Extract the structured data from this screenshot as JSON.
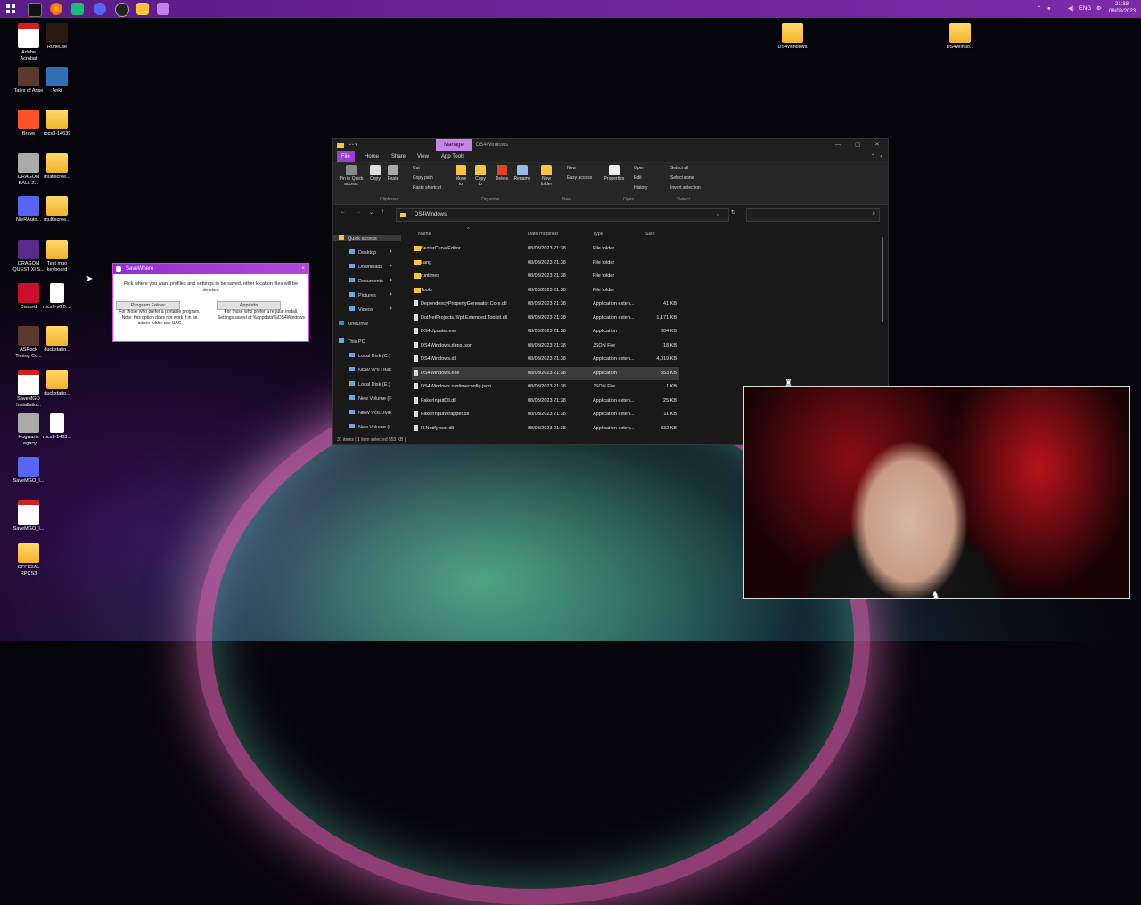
{
  "tray": {
    "lang": "ENG",
    "time": "21:38",
    "date": "08/03/2023"
  },
  "desktop_icons": [
    {
      "label": "Adobe\nAcrobat",
      "type": "pdf"
    },
    {
      "label": "RuneLite",
      "type": "app"
    },
    {
      "label": "Tales of Arise",
      "type": "app"
    },
    {
      "label": "Anki",
      "type": "app"
    },
    {
      "label": "Brave",
      "type": "app"
    },
    {
      "label": "rpcs3-14639",
      "type": "folder"
    },
    {
      "label": "DRAGON\nBALL Z...",
      "type": "app"
    },
    {
      "label": "multiscree...",
      "type": "folder"
    },
    {
      "label": "NieRAuto...",
      "type": "app"
    },
    {
      "label": "multiscree...",
      "type": "folder"
    },
    {
      "label": "DRAGON\nQUEST XI S...",
      "type": "app"
    },
    {
      "label": "Test mgo\nkeyboard",
      "type": "folder"
    },
    {
      "label": "Discord",
      "type": "app"
    },
    {
      "label": "rpcs3-v0.0....",
      "type": "file"
    },
    {
      "label": "ASRock\nTiming Co...",
      "type": "app"
    },
    {
      "label": "duckstatio...",
      "type": "folder"
    },
    {
      "label": "SaveMGO\nInstallatio...",
      "type": "pdf"
    },
    {
      "label": "duckstatio...",
      "type": "folder"
    },
    {
      "label": "Hogwarts\nLegacy",
      "type": "app"
    },
    {
      "label": "rpcs3-1463...",
      "type": "file"
    },
    {
      "label": "SaveMGO_I...",
      "type": "app"
    },
    {
      "label": "SaveMGO_I...",
      "type": "pdf"
    },
    {
      "label": "OFFICIAL\nRPCS3",
      "type": "folder"
    },
    {
      "label": "DS4Windows",
      "type": "folder"
    },
    {
      "label": "DS4Windo...",
      "type": "folder"
    }
  ],
  "explorer": {
    "window_title": "DS4Windows",
    "manage_tab": "Manage",
    "tabs": [
      "File",
      "Home",
      "Share",
      "View",
      "App Tools"
    ],
    "ribbon": {
      "pin": "Pin to Quick\naccess",
      "copy": "Copy",
      "paste": "Paste",
      "cut": "Cut",
      "copy_path": "Copy path",
      "paste_shortcut": "Paste shortcut",
      "move_to": "Move\nto",
      "copy_to": "Copy\nto",
      "delete": "Delete",
      "rename": "Rename",
      "new_folder": "New\nfolder",
      "new": "New",
      "easy_access": "Easy access",
      "properties": "Properties",
      "open": "Open",
      "edit": "Edit",
      "history": "History",
      "select_all": "Select all",
      "select_none": "Select none",
      "invert_selection": "Invert selection",
      "groups": [
        "Clipboard",
        "Organise",
        "New",
        "Open",
        "Select"
      ]
    },
    "address": "DS4Windows",
    "nav": [
      {
        "label": "Quick access",
        "level": 0,
        "pinned": false
      },
      {
        "label": "Desktop",
        "level": 1,
        "pinned": true
      },
      {
        "label": "Downloads",
        "level": 1,
        "pinned": true
      },
      {
        "label": "Documents",
        "level": 1,
        "pinned": true
      },
      {
        "label": "Pictures",
        "level": 1,
        "pinned": true
      },
      {
        "label": "Videos",
        "level": 1,
        "pinned": true
      },
      {
        "label": "OneDrive",
        "level": 0,
        "pinned": false
      },
      {
        "label": "This PC",
        "level": 0,
        "pinned": false
      },
      {
        "label": "Local Disk (C:)",
        "level": 1,
        "pinned": false
      },
      {
        "label": "NEW VOLUME",
        "level": 1,
        "pinned": false
      },
      {
        "label": "Local Disk (E:)",
        "level": 1,
        "pinned": false
      },
      {
        "label": "New Volume (F",
        "level": 1,
        "pinned": false
      },
      {
        "label": "NEW VOLUME",
        "level": 1,
        "pinned": false
      },
      {
        "label": "New Volume (I",
        "level": 1,
        "pinned": false
      }
    ],
    "columns": [
      "Name",
      "Date modified",
      "Type",
      "Size"
    ],
    "files": [
      {
        "name": "BezierCurveEditor",
        "date": "08/03/2023 21:38",
        "type": "File folder",
        "size": "",
        "kind": "folder"
      },
      {
        "name": "Lang",
        "date": "08/03/2023 21:38",
        "type": "File folder",
        "size": "",
        "kind": "folder"
      },
      {
        "name": "runtimes",
        "date": "08/03/2023 21:38",
        "type": "File folder",
        "size": "",
        "kind": "folder"
      },
      {
        "name": "Tools",
        "date": "08/03/2023 21:38",
        "type": "File folder",
        "size": "",
        "kind": "folder"
      },
      {
        "name": "DependencyPropertyGenerator.Core.dll",
        "date": "08/03/2023 21:38",
        "type": "Application exten...",
        "size": "41 KB",
        "kind": "file"
      },
      {
        "name": "DotNetProjects.Wpf.Extended.Toolkit.dll",
        "date": "08/03/2023 21:38",
        "type": "Application exten...",
        "size": "1,171 KB",
        "kind": "file"
      },
      {
        "name": "DS4Updater.exe",
        "date": "08/03/2023 21:38",
        "type": "Application",
        "size": "804 KB",
        "kind": "file"
      },
      {
        "name": "DS4Windows.deps.json",
        "date": "08/03/2023 21:38",
        "type": "JSON File",
        "size": "18 KB",
        "kind": "file"
      },
      {
        "name": "DS4Windows.dll",
        "date": "08/03/2023 21:38",
        "type": "Application exten...",
        "size": "4,019 KB",
        "kind": "file"
      },
      {
        "name": "DS4Windows.exe",
        "date": "08/03/2023 21:38",
        "type": "Application",
        "size": "553 KB",
        "kind": "file",
        "selected": true
      },
      {
        "name": "DS4Windows.runtimeconfig.json",
        "date": "08/03/2023 21:38",
        "type": "JSON File",
        "size": "1 KB",
        "kind": "file"
      },
      {
        "name": "FakerInputDll.dll",
        "date": "08/03/2023 21:38",
        "type": "Application exten...",
        "size": "25 KB",
        "kind": "file"
      },
      {
        "name": "FakerInputWrapper.dll",
        "date": "08/03/2023 21:38",
        "type": "Application exten...",
        "size": "11 KB",
        "kind": "file"
      },
      {
        "name": "H.NotifyIcon.dll",
        "date": "08/03/2023 21:38",
        "type": "Application exten...",
        "size": "332 KB",
        "kind": "file"
      }
    ],
    "status": "31 items  |  1 item selected  553 KB  |"
  },
  "dialog": {
    "title": "SaveWhere",
    "message": "Pick where you want profiles and settings to be saved, other location files will be deleted",
    "left_button": "Program Folder",
    "left_desc": "For those who prefer a portable program. Note: this option does not work if in an admin folder w/o UAC",
    "right_button": "Appdata",
    "right_desc": "For those who prefer a regular install. Settings saved at %appdata%\\DS4Windows",
    "close": "×"
  },
  "colors": {
    "accent": "#9b3fd6",
    "taskbar": "#6b2496",
    "explorer_bg": "#191919"
  }
}
